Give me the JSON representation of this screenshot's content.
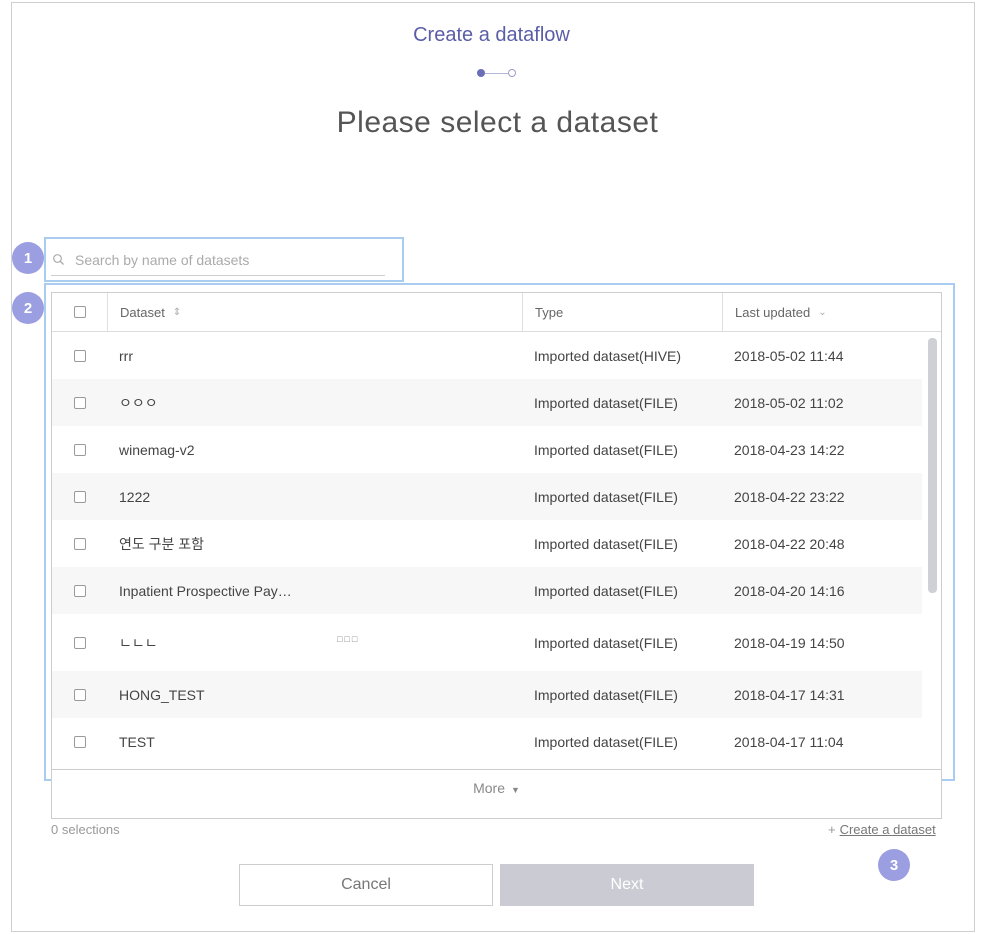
{
  "dialog": {
    "title": "Create a dataflow",
    "heading": "Please select a dataset"
  },
  "callouts": [
    "1",
    "2",
    "3"
  ],
  "search": {
    "placeholder": "Search by name of datasets",
    "icon": "search-icon"
  },
  "table": {
    "columns": {
      "dataset": "Dataset",
      "type": "Type",
      "last_updated": "Last updated"
    },
    "sort_icons": {
      "dataset": "⇕",
      "last_updated": "⌄"
    },
    "rows": [
      {
        "name": "rrr",
        "type": "Imported dataset(HIVE)",
        "updated": "2018-05-02 11:44"
      },
      {
        "name": "ㅇㅇㅇ",
        "type": "Imported dataset(FILE)",
        "updated": "2018-05-02 11:02"
      },
      {
        "name": "winemag-v2",
        "type": "Imported dataset(FILE)",
        "updated": "2018-04-23 14:22"
      },
      {
        "name": "1222",
        "type": "Imported dataset(FILE)",
        "updated": "2018-04-22 23:22"
      },
      {
        "name": "연도 구분 포함",
        "type": "Imported dataset(FILE)",
        "updated": "2018-04-22 20:48"
      },
      {
        "name": "Inpatient Prospective Pay…",
        "type": "Imported dataset(FILE)",
        "updated": "2018-04-20 14:16"
      },
      {
        "name": "ㄴㄴㄴ",
        "extra": "□□□",
        "type": "Imported dataset(FILE)",
        "updated": "2018-04-19 14:50"
      },
      {
        "name": "HONG_TEST",
        "type": "Imported dataset(FILE)",
        "updated": "2018-04-17 14:31"
      },
      {
        "name": "TEST",
        "type": "Imported dataset(FILE)",
        "updated": "2018-04-17 11:04"
      }
    ],
    "more_label": "More",
    "more_icon": "▼"
  },
  "footer": {
    "selections": "0 selections",
    "create_plus": "+",
    "create_label": "Create a dataset",
    "cancel_label": "Cancel",
    "next_label": "Next"
  },
  "colors": {
    "accent": "#5a5ea8",
    "callout_badge": "#9b9ee0",
    "callout_outline": "#a9ccf1",
    "next_disabled": "#cbcbd3"
  }
}
